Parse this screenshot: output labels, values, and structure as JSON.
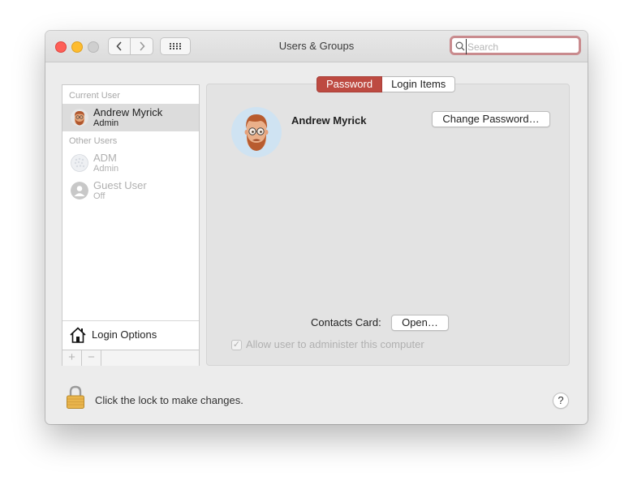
{
  "window": {
    "title": "Users & Groups"
  },
  "toolbar": {
    "back_icon": "chevron-left-icon",
    "forward_icon": "chevron-right-icon",
    "grid_icon": "grid-icon",
    "search_placeholder": "Search"
  },
  "sidebar": {
    "current_user_header": "Current User",
    "current_user": {
      "name": "Andrew Myrick",
      "role": "Admin"
    },
    "other_users_header": "Other Users",
    "other_users": [
      {
        "name": "ADM",
        "role": "Admin"
      },
      {
        "name": "Guest User",
        "role": "Off"
      }
    ],
    "login_options_label": "Login Options",
    "add_label": "+",
    "remove_label": "−"
  },
  "tabs": [
    {
      "label": "Password",
      "active": true
    },
    {
      "label": "Login Items",
      "active": false
    }
  ],
  "detail": {
    "full_name": "Andrew Myrick",
    "change_password_label": "Change Password…",
    "contacts_card_label": "Contacts Card:",
    "open_label": "Open…",
    "allow_admin_label": "Allow user to administer this computer",
    "allow_admin_checked": true
  },
  "footer": {
    "lock_text": "Click the lock to make changes.",
    "help_label": "?"
  },
  "colors": {
    "accent_tab": "#bd4a41",
    "search_focus_ring": "#c98b8e",
    "close": "#fe5f57",
    "minimize": "#febc2e"
  }
}
